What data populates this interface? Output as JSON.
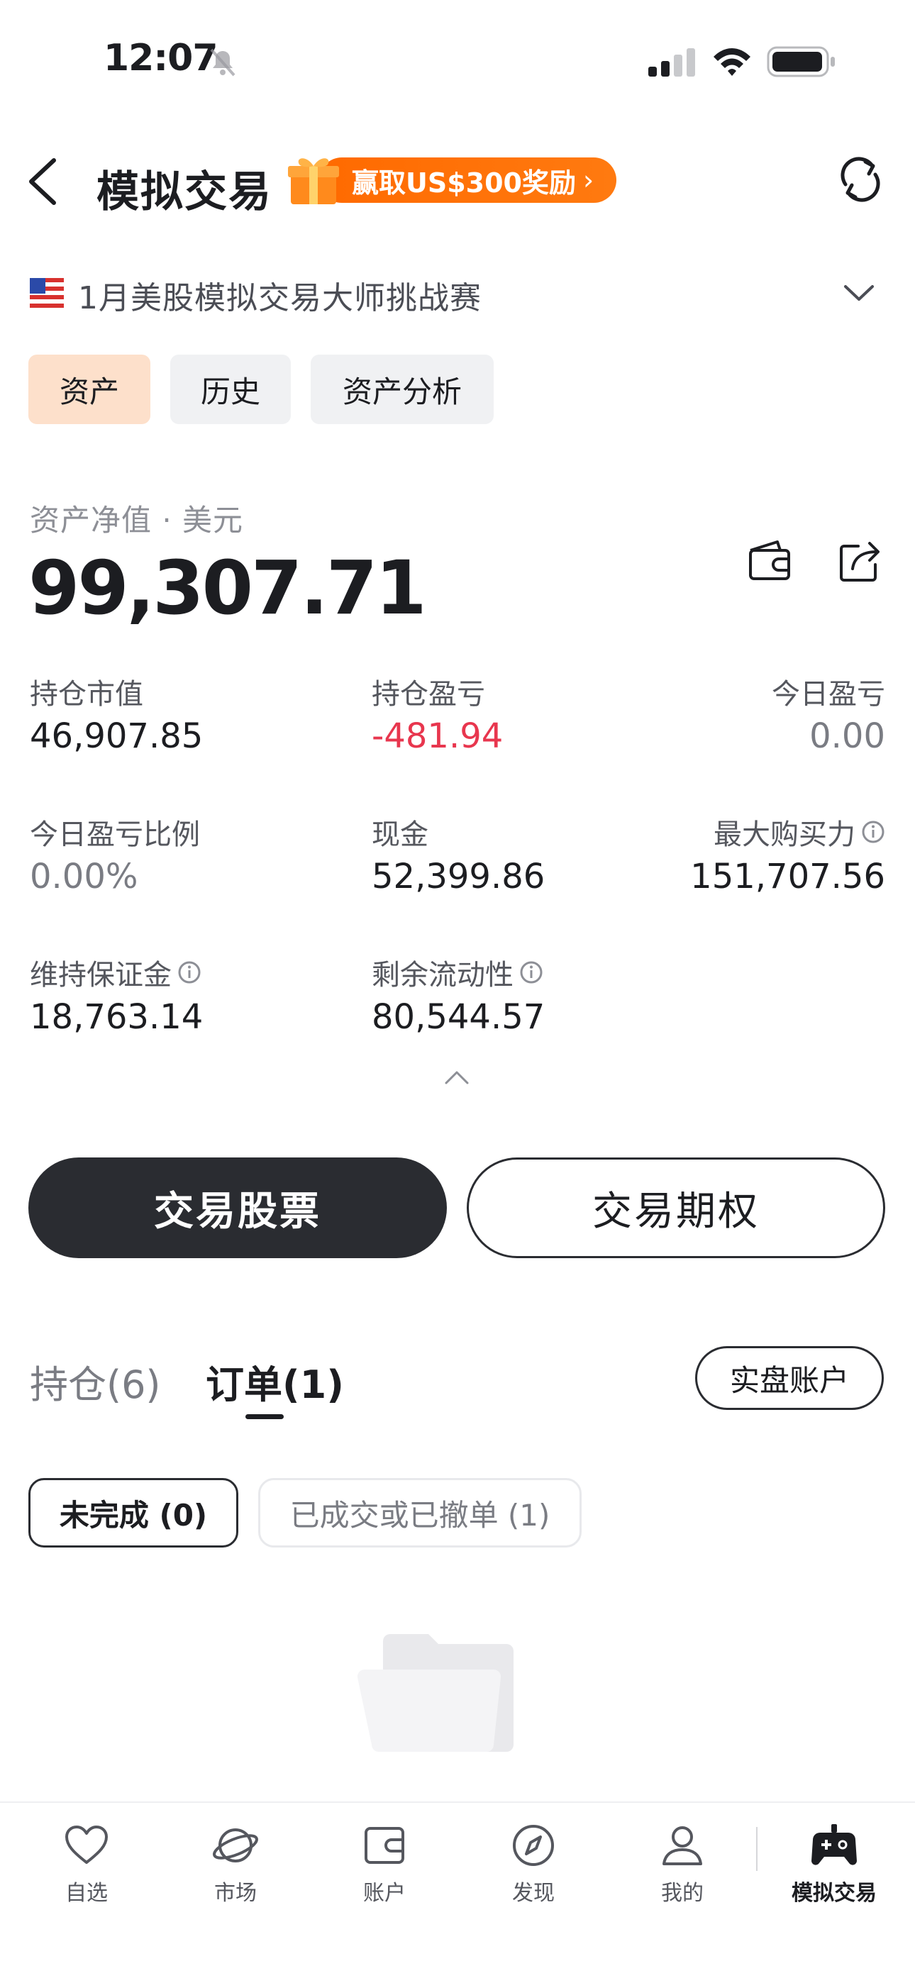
{
  "status_bar": {
    "time": "12:07"
  },
  "header": {
    "title": "模拟交易",
    "promo_label": "赢取US$300奖励",
    "promo_chevron": "›"
  },
  "competition": {
    "name": "1月美股模拟交易大师挑战赛",
    "flag_icon": "us-flag-icon"
  },
  "sub_tabs": [
    {
      "label": "资产",
      "active": true
    },
    {
      "label": "历史",
      "active": false
    },
    {
      "label": "资产分析",
      "active": false
    }
  ],
  "assets": {
    "net_value_label": "资产净值 · 美元",
    "net_value": "99,307.71",
    "metrics": [
      {
        "label": "持仓市值",
        "value": "46,907.85"
      },
      {
        "label": "持仓盈亏",
        "value": "-481.94",
        "color": "#e8364e"
      },
      {
        "label": "今日盈亏",
        "value": "0.00",
        "color": "#7a7c83"
      },
      {
        "label": "今日盈亏比例",
        "value": "0.00%",
        "color": "#7a7c83"
      },
      {
        "label": "现金",
        "value": "52,399.86"
      },
      {
        "label": "最大购买力",
        "value": "151,707.56"
      },
      {
        "label": "维持保证金",
        "value": "18,763.14"
      },
      {
        "label": "剩余流动性",
        "value": "80,544.57"
      }
    ]
  },
  "actions": {
    "trade_stock": "交易股票",
    "trade_option": "交易期权"
  },
  "order_tabs": {
    "positions": "持仓(6)",
    "orders": "订单(1)",
    "real_account": "实盘账户"
  },
  "filters": {
    "incomplete": "未完成 (0)",
    "done": "已成交或已撤单 (1)"
  },
  "bottom_nav": [
    {
      "label": "自选",
      "icon": "heart-icon"
    },
    {
      "label": "市场",
      "icon": "planet-icon"
    },
    {
      "label": "账户",
      "icon": "wallet-icon"
    },
    {
      "label": "发现",
      "icon": "compass-icon"
    },
    {
      "label": "我的",
      "icon": "person-icon"
    },
    {
      "label": "模拟交易",
      "icon": "gamepad-icon",
      "active": true
    }
  ],
  "colors": {
    "accent_orange": "#ff6a00",
    "active_tab_bg": "#fde0cb",
    "loss_red": "#e8364e",
    "dark_button": "#2a2c31"
  }
}
